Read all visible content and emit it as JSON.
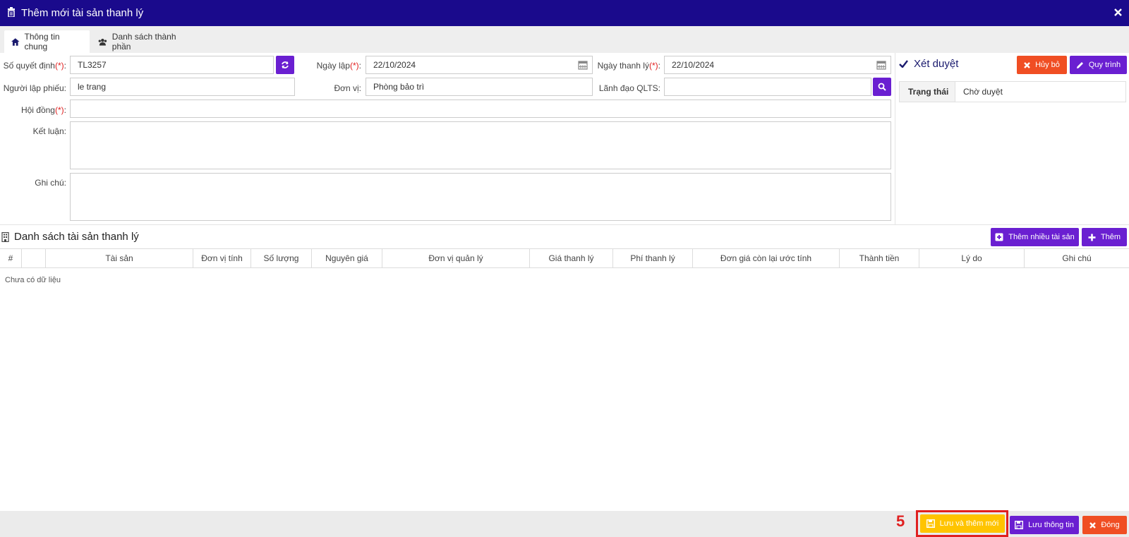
{
  "window": {
    "title": "Thêm mới tài sản thanh lý",
    "close_icon": "close-icon"
  },
  "tabs": [
    {
      "label": "Thông tin chung",
      "icon": "home-icon",
      "active": true
    },
    {
      "label": "Danh sách thành phần",
      "icon": "users-icon",
      "active": false
    }
  ],
  "form": {
    "so_quyet_dinh": {
      "label": "Số quyết định",
      "req": "(*)",
      "colon": ":",
      "value": "TL3257"
    },
    "ngay_lap": {
      "label": "Ngày lập",
      "req": "(*)",
      "colon": ":",
      "value": "22/10/2024"
    },
    "ngay_thanh_ly": {
      "label": "Ngày thanh lý",
      "req": "(*)",
      "colon": ":",
      "value": "22/10/2024"
    },
    "nguoi_lap_phieu": {
      "label": "Người lập phiếu:",
      "value": "le trang"
    },
    "don_vi": {
      "label": "Đơn vị:",
      "value": "Phòng bảo trì"
    },
    "lanh_dao_qlts": {
      "label": "Lãnh đạo QLTS:",
      "value": ""
    },
    "hoi_dong": {
      "label": "Hội đồng",
      "req": "(*)",
      "colon": ":",
      "value": ""
    },
    "ket_luan": {
      "label": "Kết luận:",
      "value": ""
    },
    "ghi_chu": {
      "label": "Ghi chú:",
      "value": ""
    }
  },
  "approval": {
    "title": "Xét duyệt",
    "cancel_label": "Hủy bỏ",
    "workflow_label": "Quy trình",
    "status_key": "Trạng thái",
    "status_value": "Chờ duyệt"
  },
  "asset_list": {
    "title": "Danh sách tài sản thanh lý",
    "add_many_label": "Thêm nhiều tài sản",
    "add_label": "Thêm",
    "columns": [
      "#",
      "",
      "Tài sản",
      "Đơn vị tính",
      "Số lượng",
      "Nguyên giá",
      "Đơn vị quản lý",
      "Giá thanh lý",
      "Phí thanh lý",
      "Đơn giá còn lại ước tính",
      "Thành tiền",
      "Lý do",
      "Ghi chú"
    ],
    "empty_text": "Chưa có dữ liệu"
  },
  "footer": {
    "step_number": "5",
    "save_and_new_label": "Lưu và thêm mới",
    "save_label": "Lưu thông tin",
    "close_label": "Đóng"
  },
  "colors": {
    "header_bg": "#1a0a8c",
    "accent_purple": "#6a1fd1",
    "danger": "#f04e23",
    "warning": "#ffc400",
    "highlight": "#e02020"
  }
}
